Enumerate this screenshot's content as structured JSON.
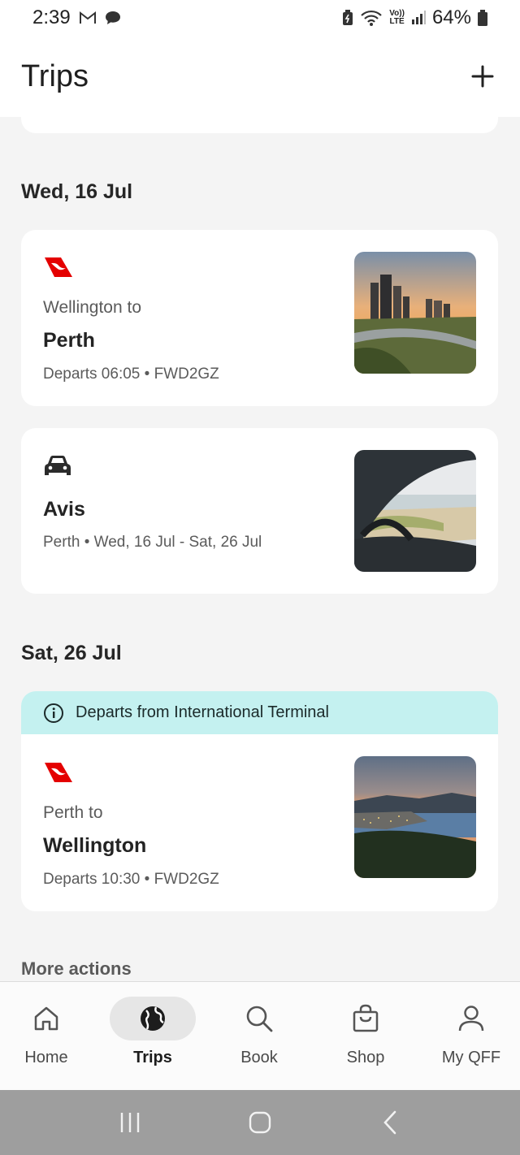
{
  "status_bar": {
    "time": "2:39",
    "battery": "64%",
    "lte_label_top": "Vo))",
    "lte_label_bottom": "LTE"
  },
  "header": {
    "title": "Trips",
    "add_icon": "plus-icon"
  },
  "sections": [
    {
      "date": "Wed, 16 Jul",
      "cards": [
        {
          "type": "flight",
          "icon": "qantas-logo",
          "origin": "Wellington to",
          "destination": "Perth",
          "meta": "Departs 06:05 • FWD2GZ",
          "image": "perth-city-skyline"
        },
        {
          "type": "car",
          "icon": "car-icon",
          "destination": "Avis",
          "meta": "Perth • Wed, 16 Jul - Sat, 26 Jul",
          "image": "car-window-beach"
        }
      ]
    },
    {
      "date": "Sat, 26 Jul",
      "cards": [
        {
          "type": "flight",
          "banner": "Departs from International Terminal",
          "icon": "qantas-logo",
          "origin": "Perth to",
          "destination": "Wellington",
          "meta": "Departs 10:30 • FWD2GZ",
          "image": "wellington-harbour-dusk"
        }
      ]
    }
  ],
  "more_actions": "More actions",
  "bottom_nav": [
    {
      "label": "Home",
      "icon": "home-icon",
      "active": false
    },
    {
      "label": "Trips",
      "icon": "globe-icon",
      "active": true
    },
    {
      "label": "Book",
      "icon": "search-icon",
      "active": false
    },
    {
      "label": "Shop",
      "icon": "shopping-bag-icon",
      "active": false
    },
    {
      "label": "My QFF",
      "icon": "person-icon",
      "active": false
    }
  ],
  "colors": {
    "qantas_red": "#e40000",
    "banner_bg": "#c4f1f0",
    "page_bg": "#f4f4f4",
    "system_nav_bg": "#9e9e9e"
  }
}
